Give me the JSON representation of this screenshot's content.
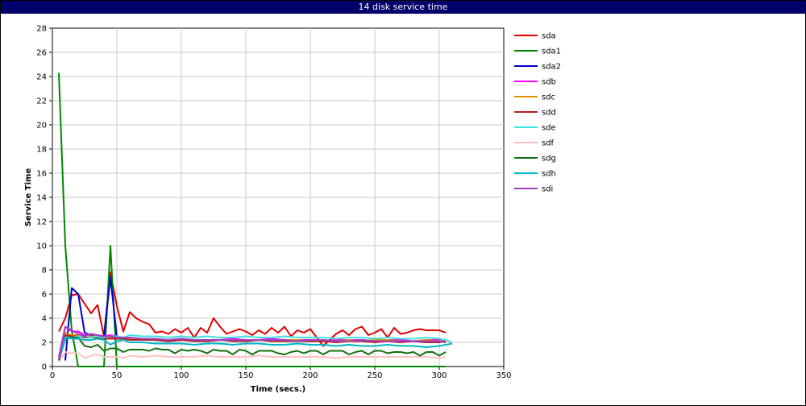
{
  "chart_data": {
    "type": "line",
    "title": "14 disk service time",
    "xlabel": "Time (secs.)",
    "ylabel": "Service Time",
    "xlim": [
      0,
      350
    ],
    "ylim": [
      0,
      28
    ],
    "xticks": [
      0,
      50,
      100,
      150,
      200,
      250,
      300,
      350
    ],
    "yticks": [
      0,
      2,
      4,
      6,
      8,
      10,
      12,
      14,
      16,
      18,
      20,
      22,
      24,
      26,
      28
    ],
    "grid": true,
    "legend_position": "right",
    "series": [
      {
        "name": "sda",
        "color": "#e00000",
        "x": [
          5,
          10,
          15,
          20,
          25,
          30,
          35,
          40,
          45,
          50,
          55,
          60,
          65,
          70,
          75,
          80,
          85,
          90,
          95,
          100,
          105,
          110,
          115,
          120,
          125,
          130,
          135,
          140,
          145,
          150,
          155,
          160,
          165,
          170,
          175,
          180,
          185,
          190,
          195,
          200,
          205,
          210,
          215,
          220,
          225,
          230,
          235,
          240,
          245,
          250,
          255,
          260,
          265,
          270,
          275,
          280,
          285,
          290,
          295,
          300,
          305
        ],
        "values": [
          2.9,
          4.0,
          5.9,
          6.0,
          5.2,
          4.4,
          5.1,
          2.5,
          7.8,
          5.0,
          2.9,
          4.5,
          4.0,
          3.7,
          3.5,
          2.8,
          2.9,
          2.7,
          3.1,
          2.8,
          3.2,
          2.4,
          3.2,
          2.8,
          4.0,
          3.3,
          2.7,
          2.9,
          3.1,
          2.9,
          2.6,
          3.0,
          2.7,
          3.2,
          2.8,
          3.3,
          2.5,
          3.0,
          2.8,
          3.1,
          2.4,
          1.7,
          2.2,
          2.7,
          3.0,
          2.6,
          3.1,
          3.3,
          2.6,
          2.8,
          3.1,
          2.4,
          3.2,
          2.7,
          2.8,
          3.0,
          3.1,
          3.0,
          3.0,
          3.0,
          2.8
        ]
      },
      {
        "name": "sda1",
        "color": "#008800",
        "x": [
          5,
          10,
          15,
          20,
          25,
          30,
          35,
          40,
          45,
          50,
          60,
          70,
          80,
          90,
          100,
          110,
          120,
          130,
          140,
          150,
          160,
          170,
          180,
          190,
          200,
          210,
          220,
          230,
          240,
          250,
          260,
          270,
          280,
          290,
          300,
          305
        ],
        "values": [
          24.3,
          10.0,
          3.0,
          0,
          0,
          0,
          0,
          0,
          10.0,
          0,
          0,
          0,
          0,
          0,
          0,
          0,
          0,
          0,
          0,
          0,
          0,
          0,
          0,
          0,
          0,
          0,
          0,
          0,
          0,
          0,
          0,
          0,
          0,
          0,
          0,
          0
        ]
      },
      {
        "name": "sda2",
        "color": "#0000d0",
        "x": [
          10,
          15,
          20,
          25,
          30,
          35,
          40,
          45,
          50,
          55,
          60,
          65,
          70,
          80,
          90,
          100,
          110,
          120,
          130,
          140,
          150,
          160,
          170,
          180,
          190,
          200,
          210,
          220,
          230,
          240,
          250,
          260,
          270,
          280,
          290,
          300,
          305
        ],
        "values": [
          0.5,
          6.5,
          6.0,
          2.8,
          2.6,
          2.5,
          2.5,
          7.4,
          2.4,
          2.3,
          2.4,
          2.3,
          2.2,
          2.2,
          2.1,
          2.2,
          2.2,
          2.1,
          2.2,
          2.2,
          2.1,
          2.2,
          2.2,
          2.1,
          2.2,
          2.1,
          2.1,
          2.2,
          2.1,
          2.2,
          2.1,
          2.2,
          2.1,
          2.1,
          2.0,
          2.1,
          2.0
        ]
      },
      {
        "name": "sdb",
        "color": "#ff00ff",
        "x": [
          5,
          10,
          15,
          20,
          25,
          30,
          35,
          40,
          45,
          50,
          55,
          60,
          65,
          70,
          80,
          90,
          100,
          110,
          120,
          130,
          140,
          150,
          160,
          170,
          180,
          190,
          200,
          210,
          220,
          230,
          240,
          250,
          260,
          270,
          280,
          290,
          300,
          305
        ],
        "values": [
          0.8,
          3.3,
          2.9,
          2.9,
          2.6,
          2.7,
          2.6,
          2.5,
          2.6,
          2.5,
          2.4,
          2.4,
          2.3,
          2.3,
          2.2,
          2.2,
          2.3,
          2.2,
          2.2,
          2.2,
          2.3,
          2.2,
          2.2,
          2.3,
          2.2,
          2.2,
          2.2,
          2.1,
          2.2,
          2.2,
          2.2,
          2.1,
          2.2,
          2.2,
          2.1,
          2.2,
          2.2,
          2.1
        ]
      },
      {
        "name": "sdc",
        "color": "#e09000",
        "x": [
          5,
          10,
          15,
          20,
          25,
          30,
          35,
          40,
          45,
          50,
          55,
          60,
          70,
          80,
          90,
          100,
          110,
          120,
          130,
          140,
          150,
          160,
          170,
          180,
          190,
          200,
          210,
          220,
          230,
          240,
          250,
          260,
          270,
          280,
          290,
          300,
          305
        ],
        "values": [
          0.6,
          2.8,
          2.6,
          2.6,
          2.5,
          2.5,
          2.5,
          2.4,
          2.4,
          2.4,
          2.3,
          2.3,
          2.3,
          2.2,
          2.2,
          2.3,
          2.2,
          2.2,
          2.2,
          2.2,
          2.2,
          2.2,
          2.1,
          2.2,
          2.2,
          2.1,
          2.2,
          2.1,
          2.2,
          2.1,
          2.2,
          2.2,
          2.1,
          2.1,
          2.2,
          2.1,
          2.2
        ]
      },
      {
        "name": "sdd",
        "color": "#b02020",
        "x": [
          5,
          10,
          15,
          20,
          25,
          30,
          35,
          40,
          45,
          50,
          55,
          60,
          70,
          80,
          90,
          100,
          110,
          120,
          130,
          140,
          150,
          160,
          170,
          180,
          190,
          200,
          210,
          220,
          230,
          240,
          250,
          260,
          270,
          280,
          290,
          300,
          305
        ],
        "values": [
          0.6,
          2.6,
          2.5,
          2.5,
          2.4,
          2.4,
          2.4,
          2.3,
          2.3,
          2.3,
          2.3,
          2.2,
          2.2,
          2.2,
          2.1,
          2.2,
          2.1,
          2.1,
          2.2,
          2.1,
          2.1,
          2.2,
          2.1,
          2.1,
          2.1,
          2.1,
          2.1,
          2.0,
          2.1,
          2.1,
          2.0,
          2.1,
          2.0,
          2.1,
          2.0,
          2.0,
          2.1
        ]
      },
      {
        "name": "sde",
        "color": "#40e0e0",
        "x": [
          5,
          10,
          15,
          20,
          25,
          30,
          35,
          40,
          45,
          50,
          55,
          60,
          70,
          80,
          90,
          100,
          110,
          120,
          130,
          140,
          150,
          160,
          170,
          180,
          190,
          200,
          210,
          220,
          230,
          240,
          250,
          260,
          270,
          280,
          290,
          300,
          305,
          310
        ],
        "values": [
          0.5,
          2.4,
          2.4,
          2.5,
          2.5,
          2.4,
          2.5,
          2.4,
          2.5,
          2.5,
          2.4,
          2.6,
          2.5,
          2.5,
          2.4,
          2.5,
          2.4,
          2.5,
          2.4,
          2.4,
          2.5,
          2.4,
          2.4,
          2.5,
          2.4,
          2.4,
          2.4,
          2.3,
          2.4,
          2.4,
          2.3,
          2.4,
          2.3,
          2.3,
          2.4,
          2.3,
          2.2,
          2.0
        ]
      },
      {
        "name": "sdf",
        "color": "#ffc0c0",
        "x": [
          5,
          10,
          15,
          20,
          25,
          30,
          35,
          40,
          45,
          50,
          55,
          60,
          70,
          80,
          90,
          100,
          110,
          120,
          130,
          140,
          150,
          160,
          170,
          180,
          190,
          200,
          210,
          220,
          230,
          240,
          250,
          260,
          270,
          280,
          290,
          300,
          305
        ],
        "values": [
          0.4,
          1.2,
          1.1,
          1.1,
          0.7,
          0.9,
          1.0,
          0.8,
          0.8,
          0.8,
          0.7,
          0.9,
          0.8,
          0.9,
          0.8,
          0.8,
          0.8,
          0.9,
          0.8,
          0.8,
          0.8,
          0.9,
          0.8,
          0.8,
          0.8,
          0.8,
          0.8,
          0.7,
          0.8,
          0.8,
          0.8,
          0.8,
          0.8,
          0.8,
          0.8,
          0.7,
          0.8
        ]
      },
      {
        "name": "sdg",
        "color": "#107010",
        "x": [
          5,
          10,
          15,
          20,
          25,
          30,
          35,
          40,
          45,
          50,
          55,
          60,
          65,
          70,
          75,
          80,
          85,
          90,
          95,
          100,
          105,
          110,
          115,
          120,
          125,
          130,
          135,
          140,
          145,
          150,
          155,
          160,
          165,
          170,
          175,
          180,
          185,
          190,
          195,
          200,
          205,
          210,
          215,
          220,
          225,
          230,
          235,
          240,
          245,
          250,
          255,
          260,
          265,
          270,
          275,
          280,
          285,
          290,
          295,
          300,
          305
        ],
        "values": [
          0.5,
          2.3,
          2.4,
          2.4,
          1.7,
          1.6,
          1.8,
          1.3,
          1.5,
          1.5,
          1.2,
          1.4,
          1.4,
          1.4,
          1.3,
          1.5,
          1.4,
          1.4,
          1.1,
          1.4,
          1.3,
          1.4,
          1.3,
          1.1,
          1.4,
          1.3,
          1.3,
          1.0,
          1.4,
          1.3,
          1.0,
          1.3,
          1.3,
          1.3,
          1.1,
          1.0,
          1.2,
          1.3,
          1.1,
          1.3,
          1.3,
          1.0,
          1.3,
          1.3,
          1.3,
          1.0,
          1.2,
          1.3,
          1.0,
          1.3,
          1.3,
          1.1,
          1.2,
          1.2,
          1.1,
          1.2,
          0.9,
          1.2,
          1.2,
          0.9,
          1.2
        ]
      },
      {
        "name": "sdh",
        "color": "#00b8c8",
        "x": [
          5,
          10,
          15,
          20,
          25,
          30,
          35,
          40,
          45,
          50,
          55,
          60,
          70,
          80,
          90,
          100,
          110,
          120,
          130,
          140,
          150,
          160,
          170,
          180,
          190,
          200,
          210,
          220,
          230,
          240,
          250,
          260,
          270,
          280,
          290,
          300,
          305,
          310
        ],
        "values": [
          0.6,
          2.4,
          2.3,
          2.3,
          2.2,
          2.2,
          2.3,
          2.2,
          1.8,
          2.1,
          2.2,
          2.0,
          2.0,
          1.9,
          1.9,
          1.9,
          1.8,
          1.9,
          1.9,
          1.8,
          1.9,
          1.9,
          1.8,
          1.8,
          1.9,
          1.8,
          1.8,
          1.7,
          1.8,
          1.7,
          1.7,
          1.8,
          1.7,
          1.7,
          1.6,
          1.7,
          1.8,
          1.9
        ]
      },
      {
        "name": "sdi",
        "color": "#a040c0",
        "x": [
          5,
          10,
          15,
          20,
          25,
          30,
          35,
          40,
          45,
          50,
          55,
          60,
          70,
          80,
          90,
          100,
          110,
          120,
          130,
          140,
          150,
          160,
          170,
          180,
          190,
          200,
          210,
          220,
          230,
          240,
          250,
          260,
          270,
          280,
          290,
          300,
          305
        ],
        "values": [
          0.6,
          3.3,
          3.0,
          2.7,
          2.5,
          2.7,
          2.6,
          2.5,
          2.5,
          2.4,
          2.4,
          2.4,
          2.3,
          2.3,
          2.2,
          2.3,
          2.2,
          2.2,
          2.2,
          2.2,
          2.2,
          2.2,
          2.2,
          2.2,
          2.1,
          2.2,
          2.2,
          2.1,
          2.1,
          2.2,
          2.1,
          2.1,
          2.1,
          2.1,
          2.1,
          2.1,
          2.0
        ]
      }
    ]
  }
}
